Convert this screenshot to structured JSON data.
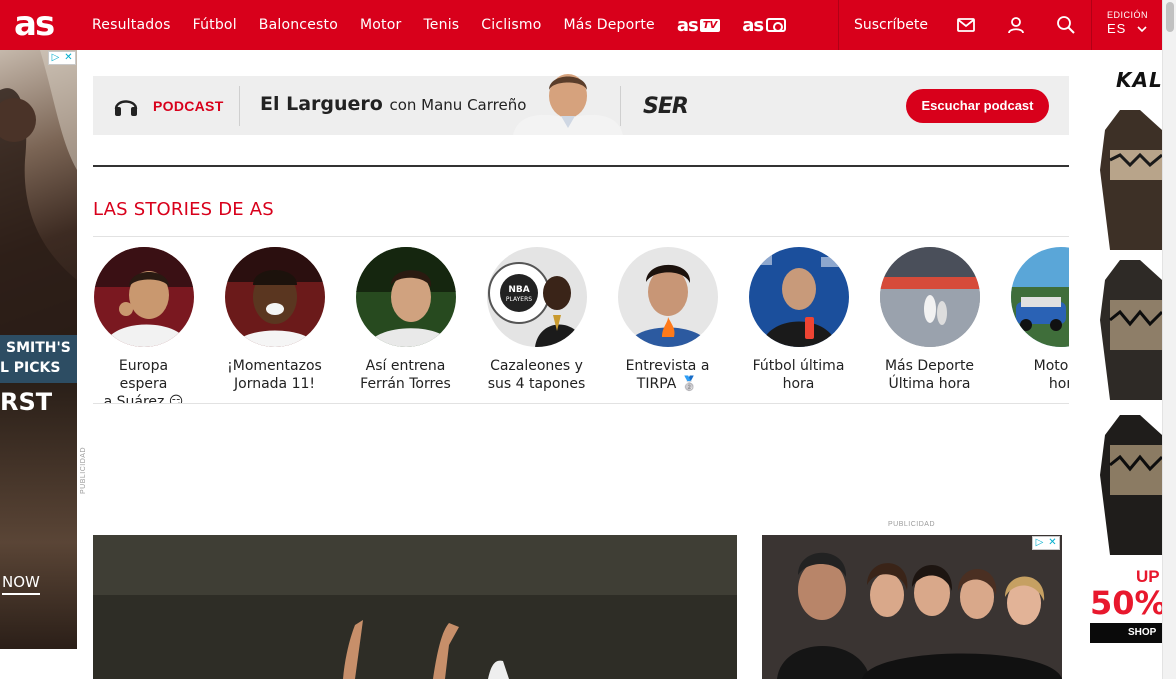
{
  "header": {
    "logo": "as",
    "nav": [
      "Resultados",
      "Fútbol",
      "Baloncesto",
      "Motor",
      "Tenis",
      "Ciclismo",
      "Más Deporte"
    ],
    "astv_logo": "as",
    "astv_tag": "TV",
    "asfoto_logo": "as",
    "subscribe": "Suscríbete",
    "edition_label": "EDICIÓN",
    "edition_value": "ES"
  },
  "podcast": {
    "label": "PODCAST",
    "show": "El Larguero",
    "with": "con Manu Carreño",
    "network": "SER",
    "cta": "Escuchar podcast"
  },
  "stories": {
    "title": "LAS STORIES DE AS",
    "items": [
      {
        "caption_l1": "Europa espera",
        "caption_l2": "a Suárez 😏"
      },
      {
        "caption_l1": "¡Momentazos",
        "caption_l2": "Jornada 11!"
      },
      {
        "caption_l1": "Así entrena",
        "caption_l2": "Ferrán Torres"
      },
      {
        "caption_l1": "Cazaleones y",
        "caption_l2": "sus 4 tapones"
      },
      {
        "caption_l1": "Entrevista a",
        "caption_l2": "TIRPA 🥈"
      },
      {
        "caption_l1": "Fútbol última",
        "caption_l2": "hora"
      },
      {
        "caption_l1": "Más Deporte",
        "caption_l2": "Última hora"
      },
      {
        "caption_l1": "Motor ú",
        "caption_l2": "hor"
      }
    ],
    "nba_badge_l1": "NBA",
    "nba_badge_l2": "PLAYERS"
  },
  "ads": {
    "left_line1": "SMITH'S",
    "left_line2": "L PICKS",
    "left_line3": "RST",
    "left_cta": "NOW",
    "publicidad": "PUBLICIDAD",
    "right_brand": "KALE",
    "right_up": "UP",
    "right_pct": "50%",
    "right_shop": "SHOP"
  },
  "colors": {
    "brand_red": "#d8001b",
    "text_dark": "#222222"
  }
}
